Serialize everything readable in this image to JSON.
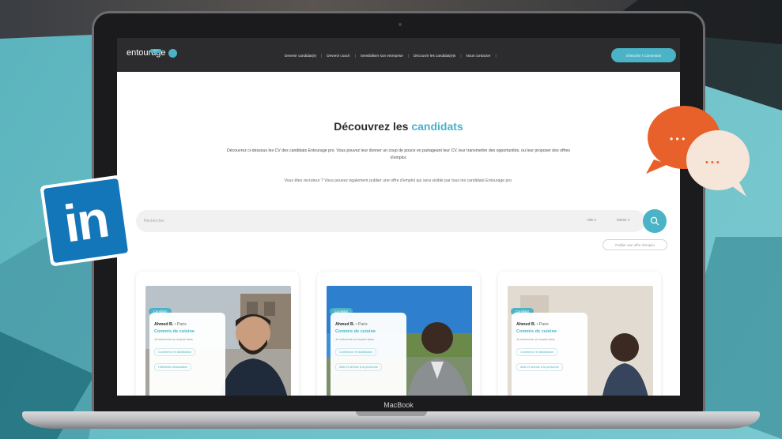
{
  "laptop": {
    "brand_label": "MacBook"
  },
  "site": {
    "logo_text": "entourage",
    "logo_badge": "pro",
    "nav": {
      "links": [
        "Devenir candidat(e)",
        "Devenir coach",
        "Sensibiliser son entreprise",
        "Découvrir les candidat(e)s",
        "Nous contacter"
      ],
      "cta": "S'inscrire / Connexion"
    },
    "title_prefix": "Découvrez les",
    "title_accent": "candidats",
    "intro": "Découvrez ci-dessous les CV des candidats Entourage pro. Vous pouvez leur donner un coup de pouce en partageant leur CV, leur transmettre des opportunités, ou leur proposer des offres d'emploi.",
    "intro2": "Vous êtes recruteur ? Vous pouvez également publier une offre d'emploi qui sera visible par tous les candidats Entourage pro.",
    "search": {
      "placeholder": "Rechercher",
      "filter1": "Ville ▾",
      "filter2": "Métier ▾"
    },
    "offers_button": "Publier une offre d'emploi",
    "candidates": [
      {
        "badge": "Candidat",
        "name": "Ahmed B.",
        "city": "• Paris",
        "role": "Commis de cuisine",
        "desc": "Je recherche un emploi dans",
        "chip1": "Commerce et distribution",
        "chip2": "Hôtellerie-restauration"
      },
      {
        "badge": "Candidat",
        "name": "Ahmed B.",
        "city": "• Paris",
        "role": "Commis de cuisine",
        "desc": "Je recherche un emploi dans",
        "chip1": "Commerce et distribution",
        "chip2": "Aide et service à la personne"
      },
      {
        "badge": "Candidat",
        "name": "Ahmed B.",
        "city": "• Paris",
        "role": "Commis de cuisine",
        "desc": "Je recherche un emploi dans",
        "chip1": "Commerce et distribution",
        "chip2": "Aide et service à la personne"
      }
    ]
  },
  "stickers": {
    "linkedin_text": "in",
    "bubble_dots": "• • •"
  },
  "colors": {
    "accent": "#4ab3c6",
    "navbar": "#2c2c2e",
    "linkedin": "#1376b8",
    "bubble_orange": "#e9612a",
    "bubble_cream": "#f6e6da",
    "background": "#6cc0c8"
  }
}
